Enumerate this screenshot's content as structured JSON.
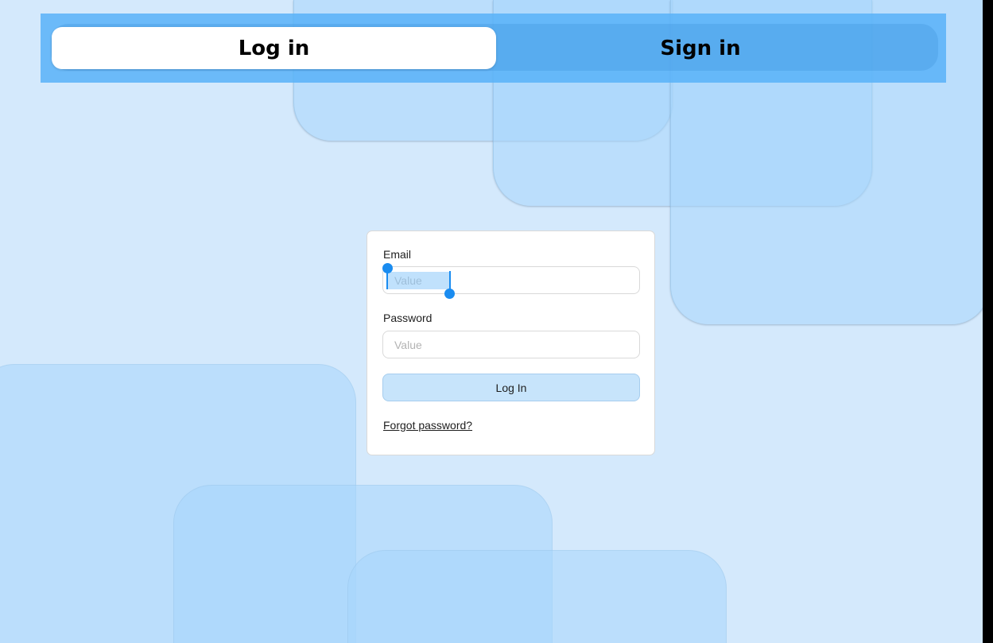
{
  "tabs": {
    "login_label": "Log in",
    "signin_label": "Sign in"
  },
  "form": {
    "email_label": "Email",
    "email_placeholder": "Value",
    "password_label": "Password",
    "password_placeholder": "Value",
    "submit_label": "Log In",
    "forgot_label": "Forgot password?"
  },
  "colors": {
    "page_background": "#d4e9fc",
    "tab_bar": "#58b2f8",
    "button_fill": "#c7e4fb",
    "selection_handle": "#1a8cf0"
  }
}
